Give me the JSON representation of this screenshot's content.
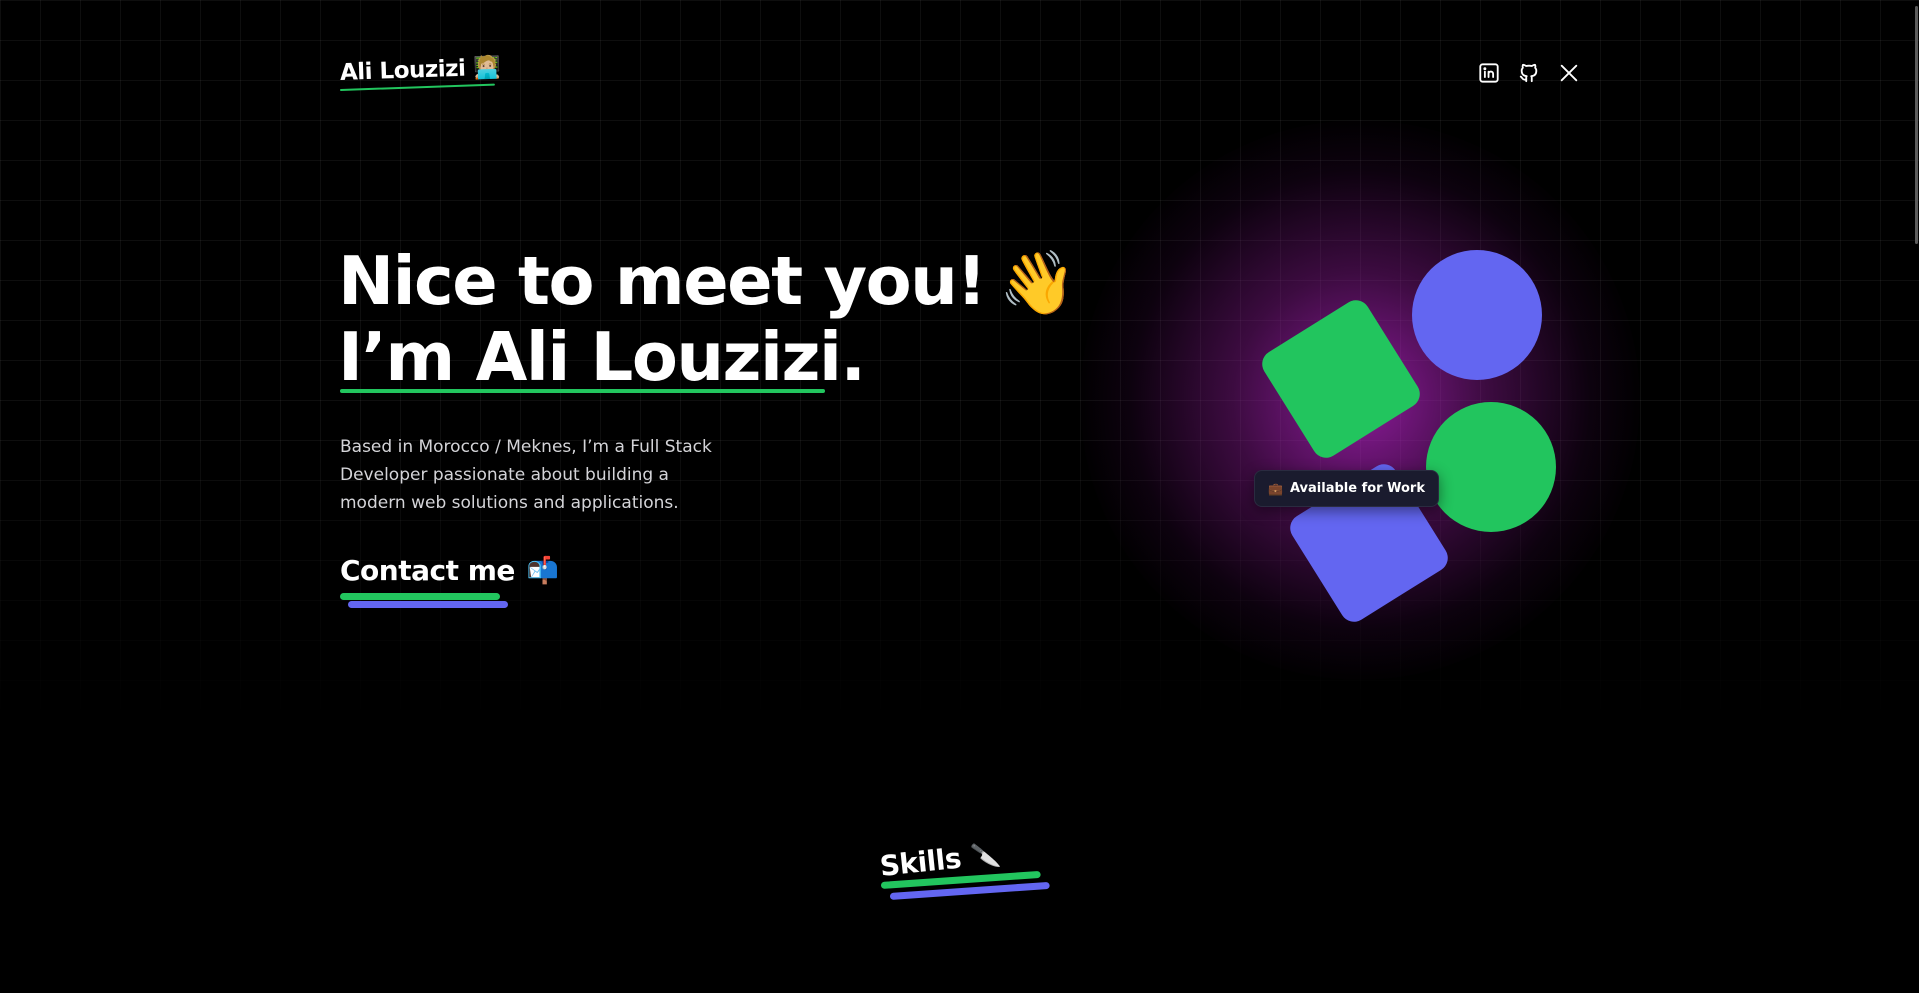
{
  "header": {
    "logo_text": "Ali Louzizi",
    "logo_emoji": "🧑🏼‍💻",
    "socials": [
      {
        "name": "LinkedIn",
        "icon": "linkedin-icon"
      },
      {
        "name": "GitHub",
        "icon": "github-icon"
      },
      {
        "name": "X",
        "icon": "x-icon"
      }
    ]
  },
  "hero": {
    "title_line1": "Nice to meet you!",
    "wave_emoji": "👋",
    "title_line2": "I’m Ali Louzizi.",
    "intro": "Based in Morocco / Meknes, I’m a Full Stack Developer passionate about building a modern web solutions and applications.",
    "contact_label": "Contact me",
    "contact_emoji": "📬"
  },
  "illustration": {
    "badge_icon": "💼",
    "badge_label": "Available for Work"
  },
  "skills": {
    "label": "Skills",
    "emoji": "🔪"
  },
  "colors": {
    "accent_green": "#22c55e",
    "accent_blue": "#6366f1",
    "glow_purple": "#c026d3",
    "background": "#000000"
  }
}
